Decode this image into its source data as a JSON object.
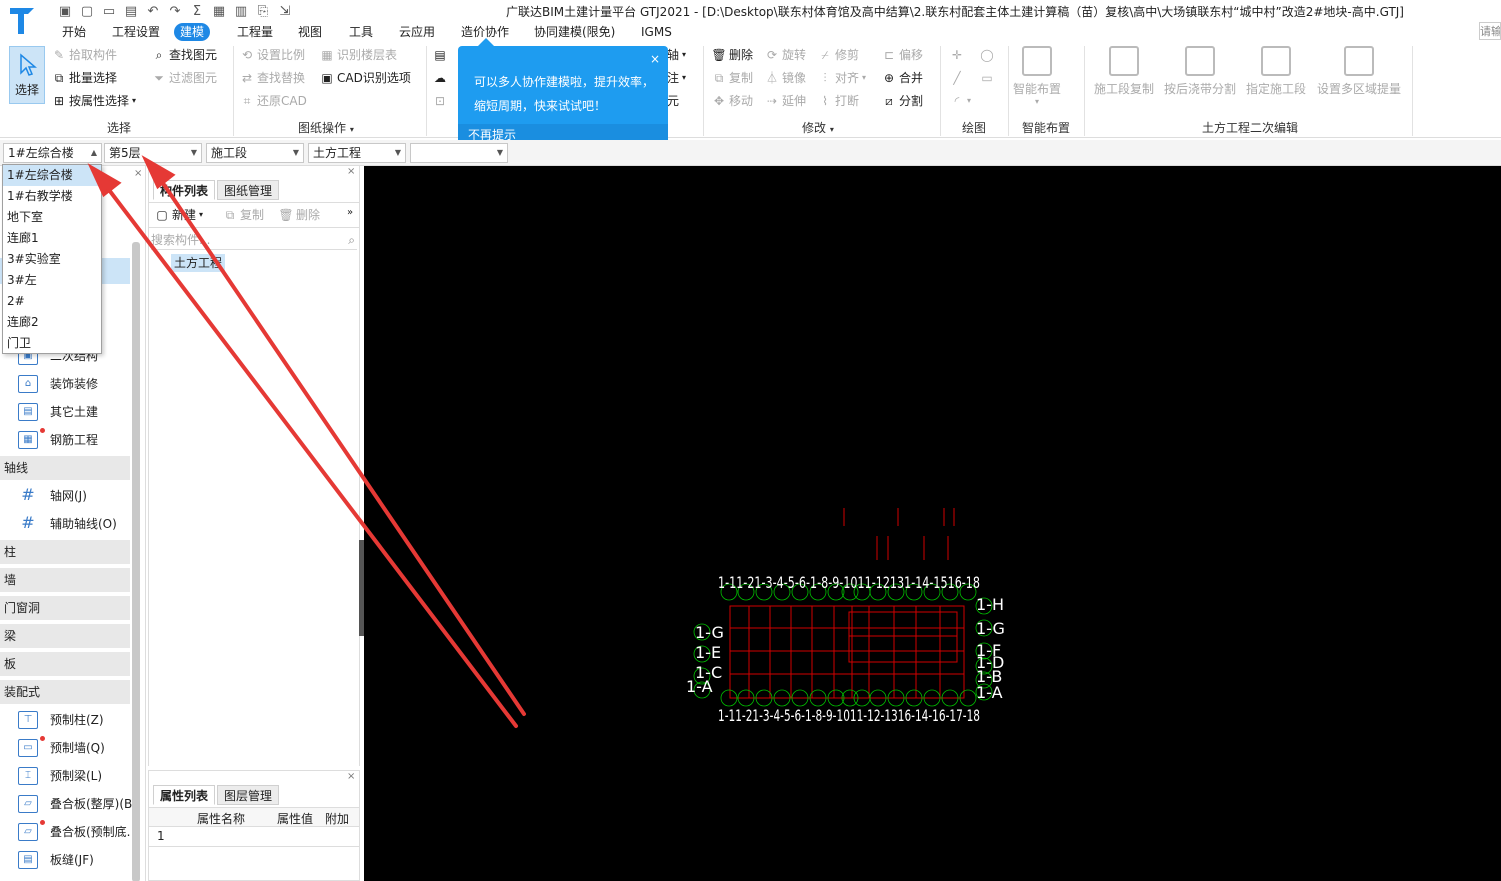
{
  "window": {
    "title": "广联达BIM土建计量平台 GTJ2021 - [D:\\Desktop\\联东村体育馆及高中结算\\2.联东村配套主体土建计算稿（苗）复核\\高中\\大场镇联东村“城中村”改造2#地块-高中.GTJ]"
  },
  "menu": {
    "tabs": [
      "开始",
      "工程设置",
      "建模",
      "工程量",
      "视图",
      "工具",
      "云应用",
      "造价协作",
      "协同建模(限免)",
      "IGMS"
    ],
    "active": "建模",
    "search_placeholder": "请输"
  },
  "ribbon": {
    "select_group": {
      "title": "选择",
      "big_button": "选择",
      "items": [
        "拾取构件",
        "批量选择",
        "按属性选择",
        "查找图元",
        "过滤图元"
      ]
    },
    "drawing_group": {
      "title": "图纸操作",
      "items": [
        "设置比例",
        "识别楼层表",
        "查找替换",
        "CAD识别选项",
        "还原CAD"
      ]
    },
    "partial_items": [
      "轴",
      "注",
      "元"
    ],
    "modify_group": {
      "title": "修改",
      "items": [
        "删除",
        "旋转",
        "修剪",
        "偏移",
        "复制",
        "镜像",
        "对齐",
        "合并",
        "移动",
        "延伸",
        "打断",
        "分割"
      ]
    },
    "draw_group": {
      "title": "绘图"
    },
    "smart_group": {
      "title": "智能布置",
      "big_button": "智能布置"
    },
    "earthwork_group": {
      "title": "土方工程二次编辑",
      "big_buttons": [
        "施工段复制",
        "按后浇带分割",
        "指定施工段",
        "设置多区域提量"
      ]
    }
  },
  "tooltip": {
    "text": "可以多人协作建模啦，提升效率，缩短周期，快来试试吧！",
    "footer": "不再提示",
    "close": "×"
  },
  "toolbar": {
    "building": "1#左综合楼",
    "floor": "第5层",
    "construction": "施工段",
    "category": "土方工程",
    "extra": ""
  },
  "building_dropdown": {
    "options": [
      "1#左综合楼",
      "1#右教学楼",
      "地下室",
      "连廊1",
      "3#实验室",
      "3#左",
      "2#",
      "连廊2",
      "门卫"
    ],
    "selected": "1#左综合楼"
  },
  "left_nav": {
    "items_top": [
      {
        "label": "二次结构",
        "icon": "secondary-structure-icon"
      },
      {
        "label": "装饰装修",
        "icon": "decoration-icon"
      },
      {
        "label": "其它土建",
        "icon": "other-civil-icon"
      },
      {
        "label": "钢筋工程",
        "icon": "rebar-icon"
      }
    ],
    "sections": [
      "轴线",
      "柱",
      "墙",
      "门窗洞",
      "梁",
      "板",
      "装配式"
    ],
    "axis_items": [
      "轴网(J)",
      "辅助轴线(O)"
    ],
    "prefab_items": [
      "预制柱(Z)",
      "预制墙(Q)",
      "预制梁(L)",
      "叠合板(整厚)(B",
      "叠合板(预制底.",
      "板缝(JF)"
    ]
  },
  "component_panel": {
    "tabs": [
      "构件列表",
      "图纸管理"
    ],
    "actions": [
      "新建",
      "复制",
      "删除"
    ],
    "search_placeholder": "搜索构件...",
    "tree_item": "土方工程"
  },
  "property_panel": {
    "tabs": [
      "属性列表",
      "图层管理"
    ],
    "headers": [
      "属性名称",
      "属性值",
      "附加"
    ],
    "rows": [
      "1"
    ]
  },
  "canvas": {
    "axis_top": "1-11-21-3-4-5-6-1-8-9-1011-12131-14-1516-18",
    "axis_bottom": "1-11-21-3-4-5-6-1-8-9-1011-12-1316-14-16-17-18",
    "axis_right": [
      "1-H",
      "1-G",
      "1-F",
      "1-D",
      "1-B",
      "1-A"
    ],
    "axis_left": [
      "1-G",
      "1-E",
      "1-C",
      "1-A"
    ]
  },
  "colors": {
    "accent": "#1e88e5",
    "tooltip": "#1e9cf0",
    "annotation_arrow": "#e53935",
    "canvas_bg": "#000000",
    "grid_red": "#d00000",
    "grid_green": "#00c000"
  }
}
